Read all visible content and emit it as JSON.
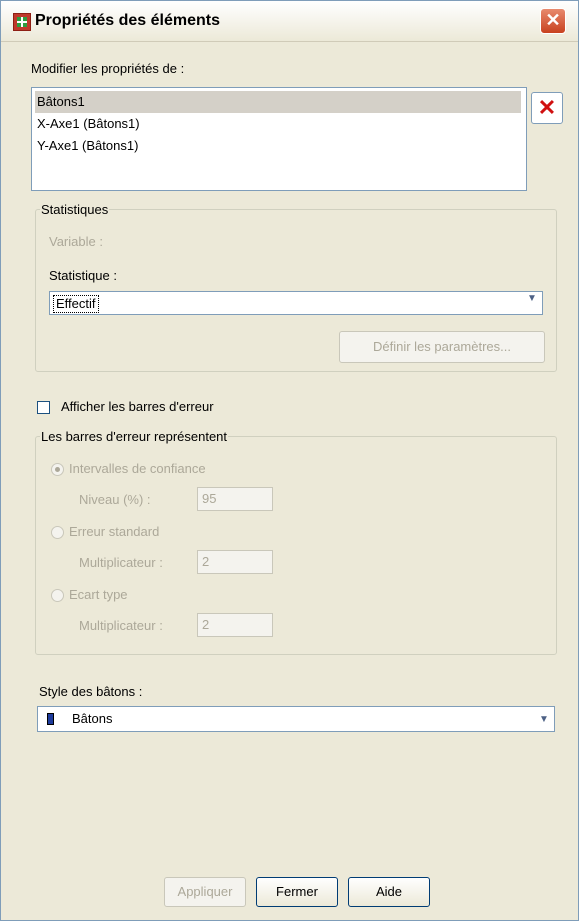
{
  "window": {
    "title": "Propriétés des éléments",
    "close_glyph": "✕"
  },
  "edit_properties": {
    "label": "Modifier les propriétés de :",
    "items": [
      {
        "label": "Bâtons1",
        "selected": true
      },
      {
        "label": "X-Axe1 (Bâtons1)",
        "selected": false
      },
      {
        "label": "Y-Axe1 (Bâtons1)",
        "selected": false
      }
    ],
    "delete_glyph": "✕"
  },
  "statistics": {
    "group_label": "Statistiques",
    "variable_label": "Variable :",
    "statistic_label": "Statistique :",
    "statistic_value": "Effectif",
    "set_parameters_label": "Définir les paramètres..."
  },
  "error_bars": {
    "show_label": "Afficher les barres d'erreur",
    "show_checked": false,
    "group_label": "Les barres d'erreur représentent",
    "options": {
      "confidence_label": "Intervalles de confiance",
      "confidence_level_label": "Niveau (%) :",
      "confidence_level_value": "95",
      "std_error_label": "Erreur standard",
      "std_error_multiplier_label": "Multiplicateur :",
      "std_error_multiplier_value": "2",
      "std_dev_label": "Ecart type",
      "std_dev_multiplier_label": "Multiplicateur :",
      "std_dev_multiplier_value": "2"
    },
    "selected_option": "confidence"
  },
  "bar_style": {
    "label": "Style des bâtons :",
    "value": "Bâtons"
  },
  "buttons": {
    "apply": "Appliquer",
    "close": "Fermer",
    "help": "Aide"
  },
  "colors": {
    "dialog_bg": "#ece9d8",
    "accent": "#003c74",
    "disabled_text": "#aca899",
    "delete_red": "#d01010"
  }
}
